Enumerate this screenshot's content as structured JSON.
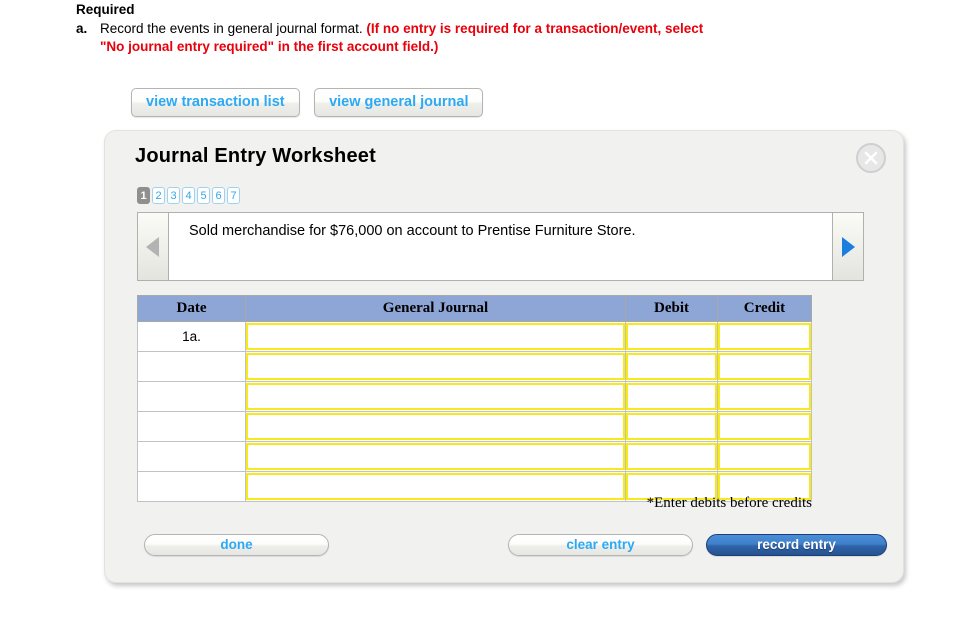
{
  "instructions": {
    "heading": "Required",
    "letter": "a.",
    "text_plain": "Record the events in general journal format.",
    "text_red_line1": "(If no entry is required for a transaction/event, select",
    "text_red_line2": "\"No journal entry required\" in the first account field.)",
    "red_color": "#e8000b"
  },
  "view_buttons": [
    {
      "label": "view transaction list",
      "name": "view-transaction-list-button"
    },
    {
      "label": "view general journal",
      "name": "view-general-journal-button"
    }
  ],
  "panel": {
    "title": "Journal Entry Worksheet",
    "close_label": "X",
    "accent_blue": "#2ca9f5",
    "header_blue": "#8da6d6",
    "input_yellow": "#f6ea1c"
  },
  "pager": {
    "active": "1",
    "pages": [
      "1",
      "2",
      "3",
      "4",
      "5",
      "6",
      "7"
    ]
  },
  "navigator": {
    "prev_label": "◀",
    "next_label": "▶",
    "prev_enabled": false,
    "next_enabled": true,
    "transaction_text": "Sold merchandise for $76,000 on account to Prentise Furniture Store."
  },
  "table": {
    "columns": [
      "Date",
      "General Journal",
      "Debit",
      "Credit"
    ],
    "rows": [
      {
        "date": "1a.",
        "general_journal": "",
        "debit": "",
        "credit": ""
      },
      {
        "date": "",
        "general_journal": "",
        "debit": "",
        "credit": ""
      },
      {
        "date": "",
        "general_journal": "",
        "debit": "",
        "credit": ""
      },
      {
        "date": "",
        "general_journal": "",
        "debit": "",
        "credit": ""
      },
      {
        "date": "",
        "general_journal": "",
        "debit": "",
        "credit": ""
      },
      {
        "date": "",
        "general_journal": "",
        "debit": "",
        "credit": ""
      }
    ],
    "note": "*Enter debits before credits"
  },
  "footer_buttons": {
    "done": "done",
    "clear": "clear entry",
    "record": "record entry"
  }
}
